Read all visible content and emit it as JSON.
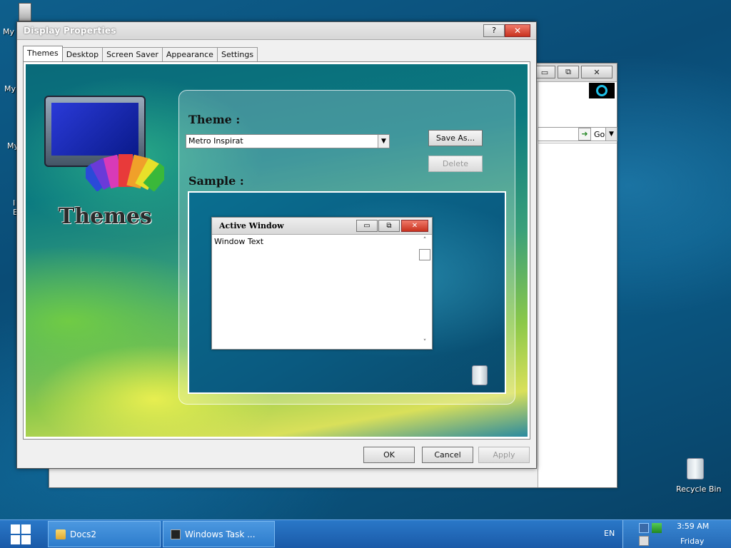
{
  "desktop": {
    "icon_labels": [
      "My",
      "My",
      "My",
      "I",
      "E"
    ],
    "recycle_bin_label": "Recycle Bin"
  },
  "background_window": {
    "minimize": "▭",
    "maximize": "⧉",
    "close": "✕",
    "go_label": "Go"
  },
  "dialog": {
    "title": "Display Properties",
    "help_label": "?",
    "close_label": "✕",
    "tabs": [
      {
        "label": "Themes",
        "active": true
      },
      {
        "label": "Desktop",
        "active": false
      },
      {
        "label": "Screen Saver",
        "active": false
      },
      {
        "label": "Appearance",
        "active": false
      },
      {
        "label": "Settings",
        "active": false
      }
    ],
    "art_title": "Themes",
    "theme_label": "Theme :",
    "theme_value": "Metro Inspirat",
    "save_as_label": "Save As...",
    "delete_label": "Delete",
    "sample_label": "Sample :",
    "sample_window": {
      "title": "Active Window",
      "text": "Window Text",
      "minimize": "▭",
      "maximize": "⧉",
      "close": "✕"
    },
    "ok_label": "OK",
    "cancel_label": "Cancel",
    "apply_label": "Apply"
  },
  "taskbar": {
    "buttons": [
      {
        "label": "Docs2",
        "icon": "folder-icon"
      },
      {
        "label": "Windows Task ...",
        "icon": "task-manager-icon"
      }
    ],
    "language": "EN",
    "time": "3:59 AM",
    "day": "Friday"
  },
  "colors": {
    "taskbar": "#2a78c8",
    "close_red": "#c8321f"
  }
}
